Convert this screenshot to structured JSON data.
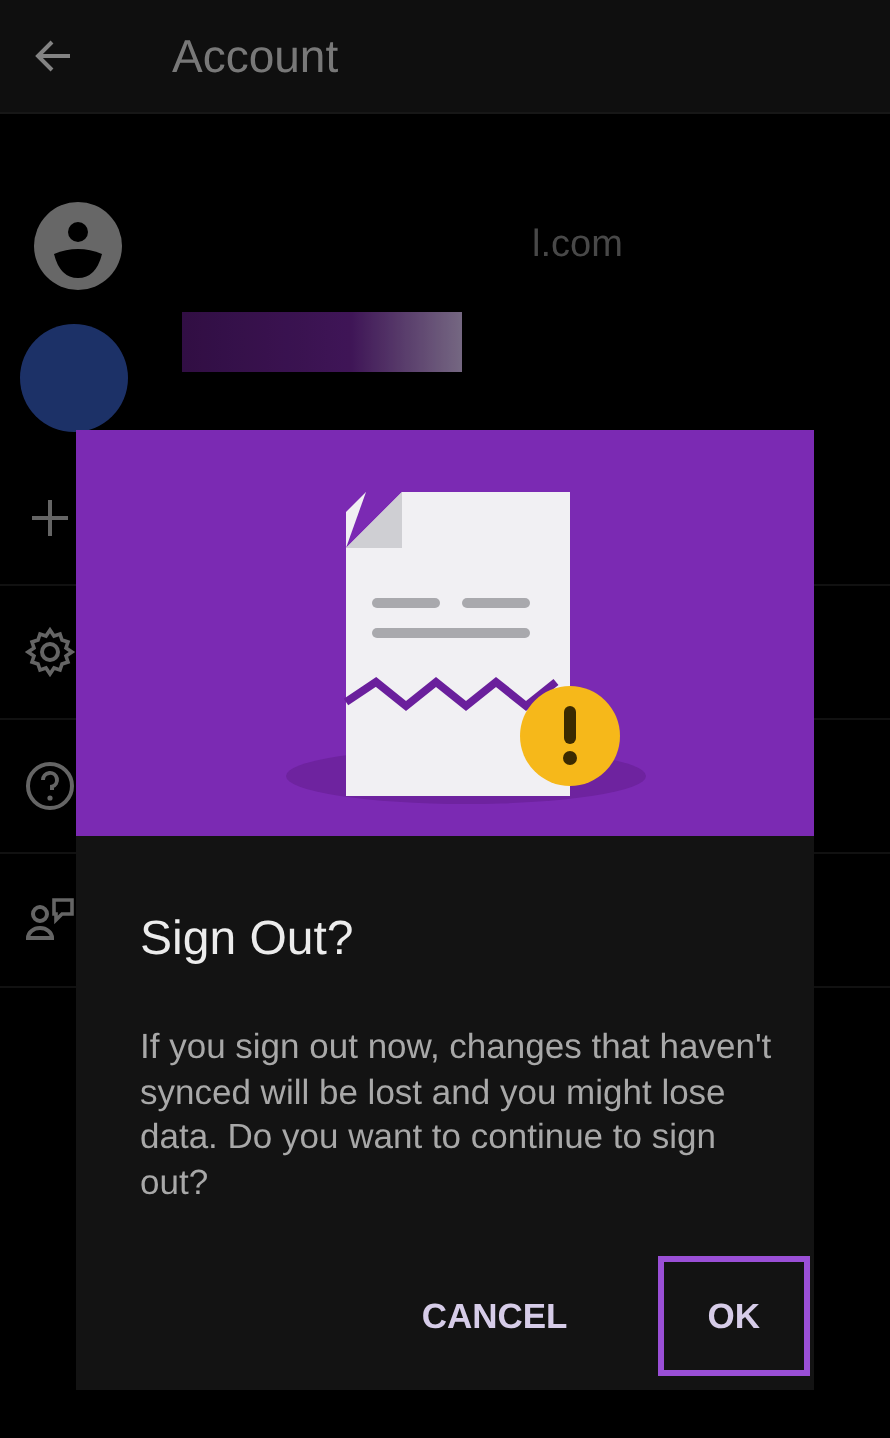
{
  "app_bar": {
    "title": "Account"
  },
  "account": {
    "email_visible": "l.com"
  },
  "menu_items": [
    {
      "kind": "add"
    },
    {
      "kind": "settings"
    },
    {
      "kind": "help"
    },
    {
      "kind": "feedback"
    }
  ],
  "dialog": {
    "title": "Sign Out?",
    "message": "If you sign out now, changes that haven't synced will be lost and you might lose data. Do you want to continue to sign out?",
    "buttons": [
      {
        "label": "CANCEL",
        "highlighted": false
      },
      {
        "label": "OK",
        "highlighted": true
      }
    ]
  }
}
